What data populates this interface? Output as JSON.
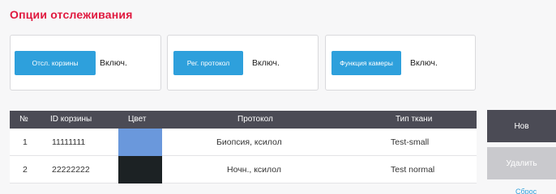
{
  "title": "Опции отслеживания",
  "options": [
    {
      "button": "Отсл. корзины",
      "state": "Включ."
    },
    {
      "button": "Рег. протокол",
      "state": "Включ."
    },
    {
      "button": "Функция камеры",
      "state": "Включ."
    }
  ],
  "table": {
    "headers": {
      "num": "№",
      "id": "ID корзины",
      "color": "Цвет",
      "protocol": "Протокол",
      "tissue": "Тип ткани"
    },
    "rows": [
      {
        "num": "1",
        "id": "11111111",
        "color": "#6a98dc",
        "protocol": "Биопсия, ксилол",
        "tissue": "Test-small"
      },
      {
        "num": "2",
        "id": "22222222",
        "color": "#1c2224",
        "protocol": "Ночн., ксилол",
        "tissue": "Test normal"
      }
    ]
  },
  "side": {
    "new": "Нов",
    "delete": "Удалить",
    "link": "Сброс"
  },
  "colors": {
    "accent": "#2ea0dc",
    "title": "#e0193f",
    "header": "#4b4b55",
    "new_button": "#4b4b55",
    "delete_button": "#c9c9cd"
  }
}
